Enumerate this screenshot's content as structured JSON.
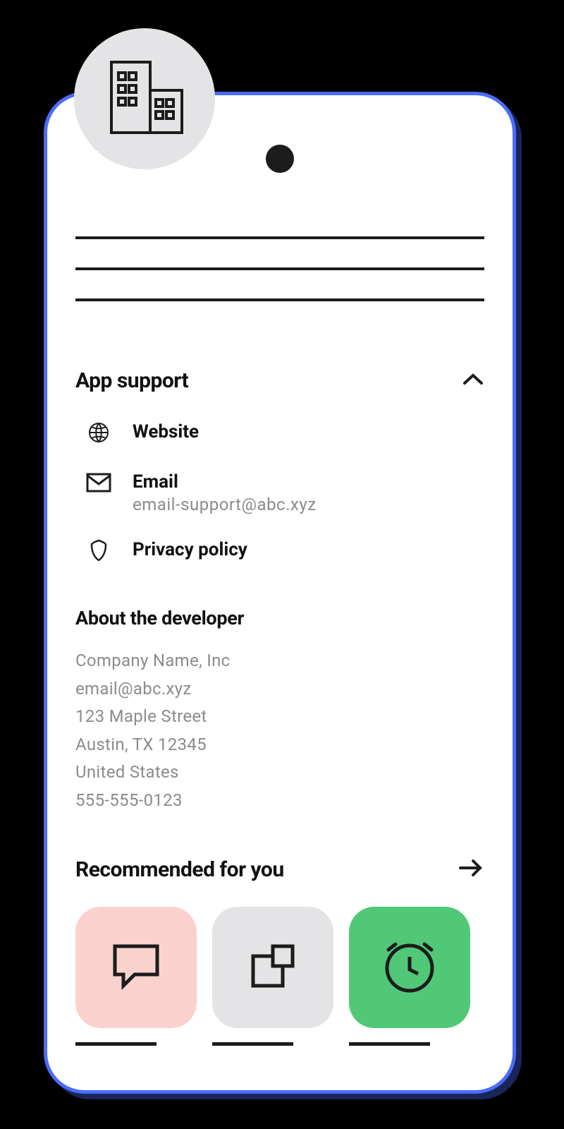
{
  "appSupport": {
    "title": "App support",
    "items": [
      {
        "label": "Website",
        "sublabel": null,
        "icon": "globe-icon"
      },
      {
        "label": "Email",
        "sublabel": "email-support@abc.xyz",
        "icon": "mail-icon"
      },
      {
        "label": "Privacy policy",
        "sublabel": null,
        "icon": "shield-icon"
      }
    ]
  },
  "aboutDeveloper": {
    "title": "About the developer",
    "company": "Company Name, Inc",
    "email": "email@abc.xyz",
    "street": "123 Maple Street",
    "cityStateZip": "Austin, TX 12345",
    "country": "United States",
    "phone": "555-555-0123"
  },
  "recommended": {
    "title": "Recommended for you",
    "apps": [
      {
        "icon": "chat-icon",
        "bgColor": "pink"
      },
      {
        "icon": "copy-icon",
        "bgColor": "gray"
      },
      {
        "icon": "clock-icon",
        "bgColor": "green"
      }
    ]
  }
}
